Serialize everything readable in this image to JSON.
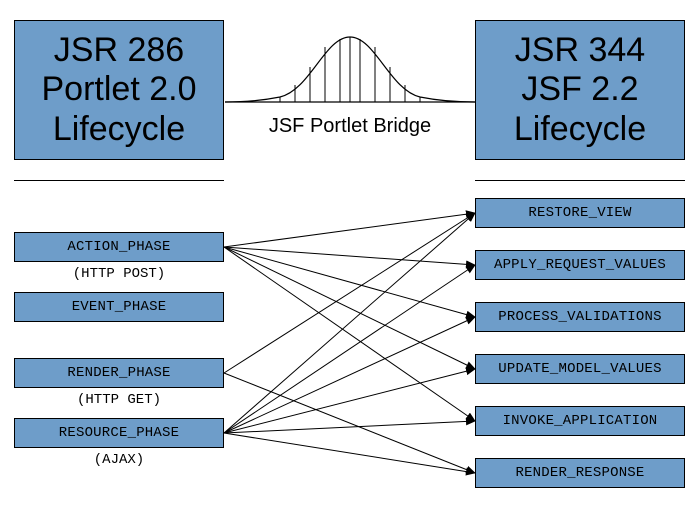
{
  "header": {
    "left": {
      "line1": "JSR 286",
      "line2": "Portlet 2.0",
      "line3": "Lifecycle"
    },
    "right": {
      "line1": "JSR 344",
      "line2": "JSF 2.2",
      "line3": "Lifecycle"
    },
    "bridge_label": "JSF Portlet Bridge"
  },
  "left_phases": {
    "action": {
      "label": "ACTION_PHASE",
      "note": "(HTTP POST)"
    },
    "event": {
      "label": "EVENT_PHASE"
    },
    "render": {
      "label": "RENDER_PHASE",
      "note": "(HTTP GET)"
    },
    "resource": {
      "label": "RESOURCE_PHASE",
      "note": "(AJAX)"
    }
  },
  "right_phases": {
    "restore_view": "RESTORE_VIEW",
    "apply_request_values": "APPLY_REQUEST_VALUES",
    "process_validations": "PROCESS_VALIDATIONS",
    "update_model_values": "UPDATE_MODEL_VALUES",
    "invoke_application": "INVOKE_APPLICATION",
    "render_response": "RENDER_RESPONSE"
  },
  "arrows": [
    {
      "from": "action",
      "to": "restore_view"
    },
    {
      "from": "action",
      "to": "apply_request_values"
    },
    {
      "from": "action",
      "to": "process_validations"
    },
    {
      "from": "action",
      "to": "update_model_values"
    },
    {
      "from": "action",
      "to": "invoke_application"
    },
    {
      "from": "render",
      "to": "restore_view"
    },
    {
      "from": "render",
      "to": "render_response"
    },
    {
      "from": "resource",
      "to": "restore_view"
    },
    {
      "from": "resource",
      "to": "apply_request_values"
    },
    {
      "from": "resource",
      "to": "process_validations"
    },
    {
      "from": "resource",
      "to": "update_model_values"
    },
    {
      "from": "resource",
      "to": "invoke_application"
    },
    {
      "from": "resource",
      "to": "render_response"
    }
  ]
}
